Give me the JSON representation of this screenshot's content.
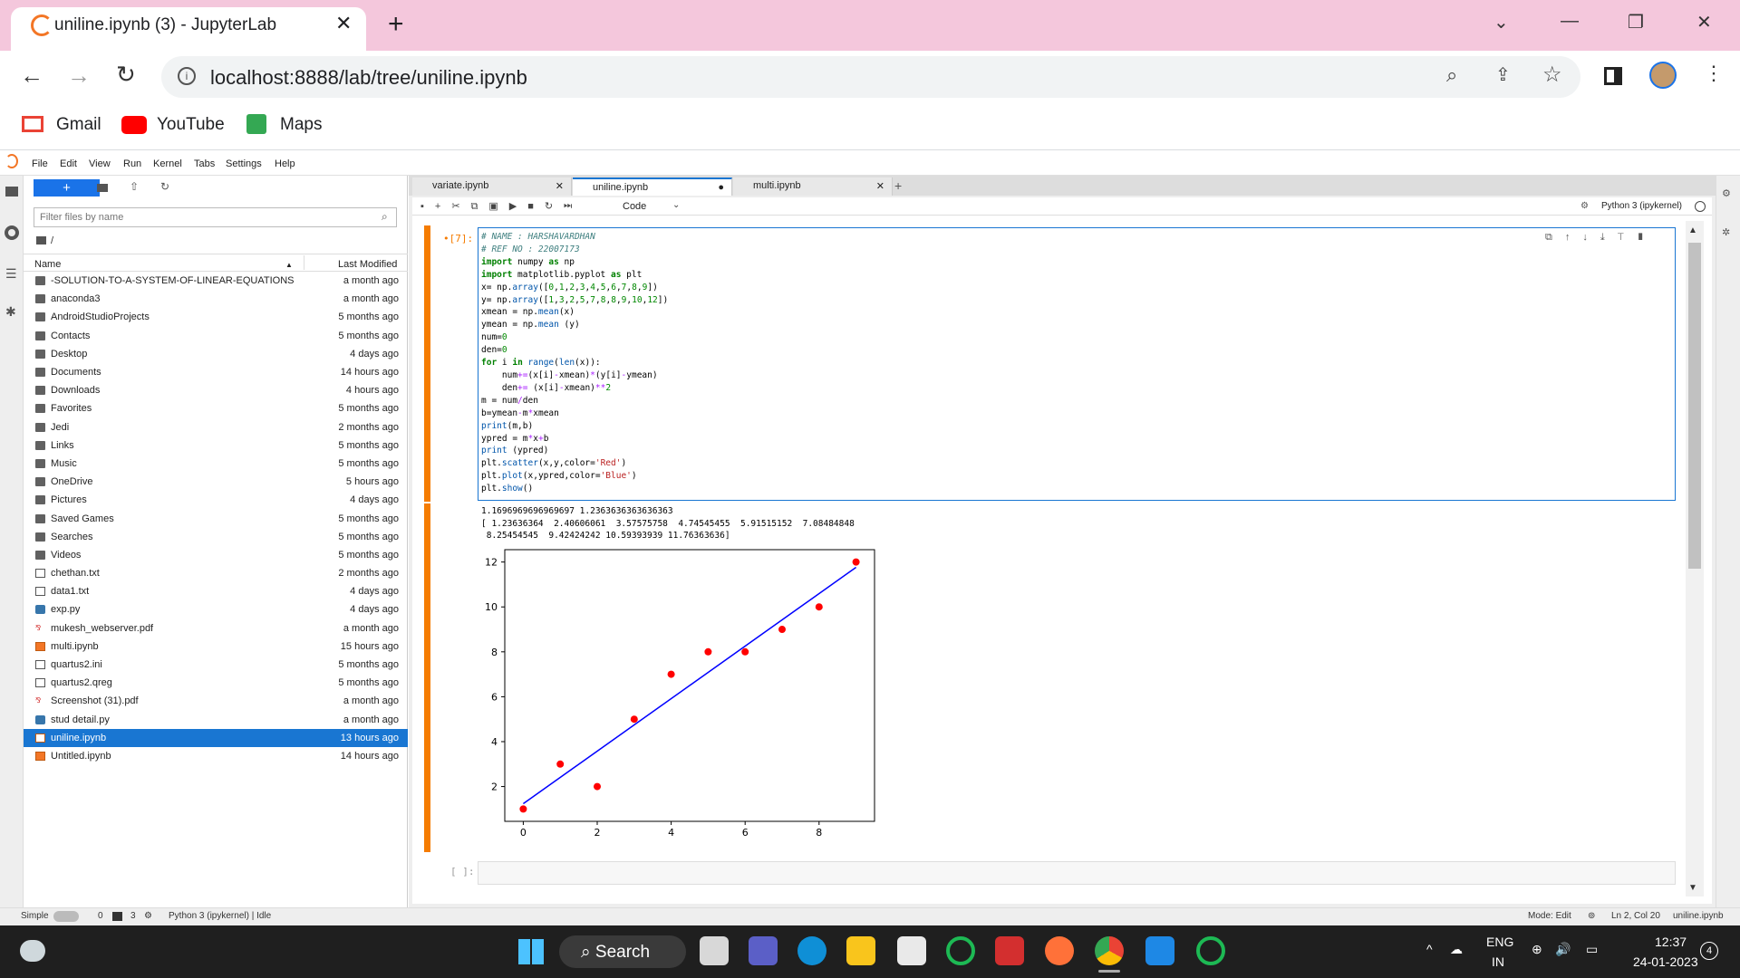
{
  "browser": {
    "tab_title": "uniline.ipynb (3) - JupyterLab",
    "url": "localhost:8888/lab/tree/uniline.ipynb",
    "bookmarks": [
      "Gmail",
      "YouTube",
      "Maps"
    ]
  },
  "menu": [
    "File",
    "Edit",
    "View",
    "Run",
    "Kernel",
    "Tabs",
    "Settings",
    "Help"
  ],
  "filebrowser": {
    "filter_placeholder": "Filter files by name",
    "path": "/",
    "col_name": "Name",
    "col_modified": "Last Modified",
    "files": [
      {
        "name": "-SOLUTION-TO-A-SYSTEM-OF-LINEAR-EQUATIONS",
        "modified": "a month ago",
        "type": "folder"
      },
      {
        "name": "anaconda3",
        "modified": "a month ago",
        "type": "folder"
      },
      {
        "name": "AndroidStudioProjects",
        "modified": "5 months ago",
        "type": "folder"
      },
      {
        "name": "Contacts",
        "modified": "5 months ago",
        "type": "folder"
      },
      {
        "name": "Desktop",
        "modified": "4 days ago",
        "type": "folder"
      },
      {
        "name": "Documents",
        "modified": "14 hours ago",
        "type": "folder"
      },
      {
        "name": "Downloads",
        "modified": "4 hours ago",
        "type": "folder"
      },
      {
        "name": "Favorites",
        "modified": "5 months ago",
        "type": "folder"
      },
      {
        "name": "Jedi",
        "modified": "2 months ago",
        "type": "folder"
      },
      {
        "name": "Links",
        "modified": "5 months ago",
        "type": "folder"
      },
      {
        "name": "Music",
        "modified": "5 months ago",
        "type": "folder"
      },
      {
        "name": "OneDrive",
        "modified": "5 hours ago",
        "type": "folder"
      },
      {
        "name": "Pictures",
        "modified": "4 days ago",
        "type": "folder"
      },
      {
        "name": "Saved Games",
        "modified": "5 months ago",
        "type": "folder"
      },
      {
        "name": "Searches",
        "modified": "5 months ago",
        "type": "folder"
      },
      {
        "name": "Videos",
        "modified": "5 months ago",
        "type": "folder"
      },
      {
        "name": "chethan.txt",
        "modified": "2 months ago",
        "type": "file"
      },
      {
        "name": "data1.txt",
        "modified": "4 days ago",
        "type": "file"
      },
      {
        "name": "exp.py",
        "modified": "4 days ago",
        "type": "py"
      },
      {
        "name": "mukesh_webserver.pdf",
        "modified": "a month ago",
        "type": "pdf"
      },
      {
        "name": "multi.ipynb",
        "modified": "15 hours ago",
        "type": "nb"
      },
      {
        "name": "quartus2.ini",
        "modified": "5 months ago",
        "type": "file"
      },
      {
        "name": "quartus2.qreg",
        "modified": "5 months ago",
        "type": "file"
      },
      {
        "name": "Screenshot (31).pdf",
        "modified": "a month ago",
        "type": "pdf"
      },
      {
        "name": "stud detail.py",
        "modified": "a month ago",
        "type": "py"
      },
      {
        "name": "uniline.ipynb",
        "modified": "13 hours ago",
        "type": "nb",
        "selected": true
      },
      {
        "name": "Untitled.ipynb",
        "modified": "14 hours ago",
        "type": "nb"
      }
    ]
  },
  "notebook": {
    "tabs": [
      "variate.ipynb",
      "uniline.ipynb",
      "multi.ipynb"
    ],
    "kernel": "Python 3 (ipykernel)",
    "cell_type": "Code",
    "prompt": "[7]:",
    "empty_prompt": "[ ]:",
    "output_lines": [
      "1.1696969696969697 1.2363636363636363",
      "[ 1.23636364  2.40606061  3.57575758  4.74545455  5.91515152  7.08484848",
      " 8.25454545  9.42424242 10.59393939 11.76363636]"
    ]
  },
  "chart_data": {
    "type": "scatter",
    "x": [
      0,
      1,
      2,
      3,
      4,
      5,
      6,
      7,
      8,
      9
    ],
    "y": [
      1,
      3,
      2,
      5,
      7,
      8,
      8,
      9,
      10,
      12
    ],
    "line": {
      "x": [
        0,
        9
      ],
      "y": [
        1.2364,
        11.7636
      ]
    },
    "xticks": [
      0,
      2,
      4,
      6,
      8
    ],
    "yticks": [
      2,
      4,
      6,
      8,
      10,
      12
    ],
    "xlim": [
      -0.5,
      9.5
    ],
    "ylim": [
      0.45,
      12.55
    ],
    "point_color": "#ff0000",
    "line_color": "#0000ff"
  },
  "status": {
    "mode": "Simple",
    "counts_a": "0",
    "counts_b": "3",
    "kernel_status": "Python 3 (ipykernel) | Idle",
    "mode_edit": "Mode: Edit",
    "cursor": "Ln 2, Col 20",
    "file": "uniline.ipynb"
  },
  "taskbar": {
    "search": "Search",
    "lang1": "ENG",
    "lang2": "IN",
    "time": "12:37",
    "date": "24-01-2023",
    "badge": "4"
  }
}
